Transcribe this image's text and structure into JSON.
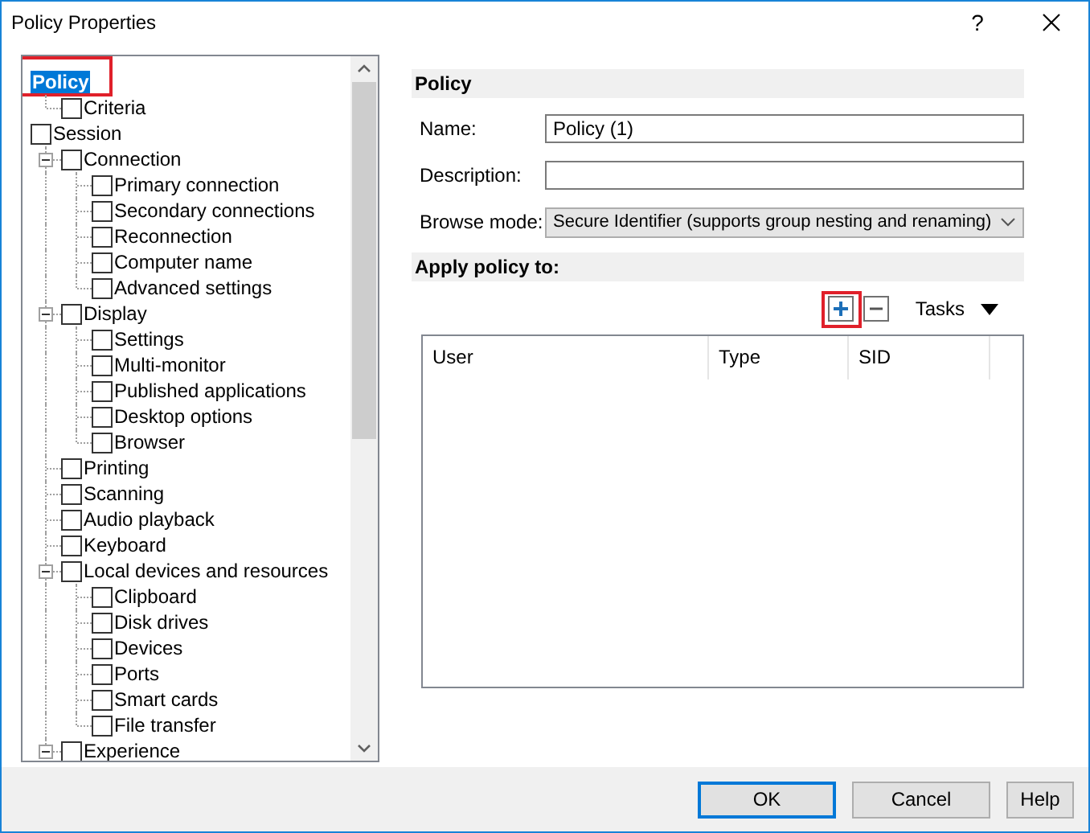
{
  "window": {
    "title": "Policy Properties",
    "help": "?"
  },
  "tree": [
    {
      "label": "Policy",
      "kind": "plain",
      "selected": true,
      "highlighted": true,
      "children": [
        {
          "label": "Criteria",
          "kind": "check",
          "checked": false,
          "selected": false
        }
      ]
    },
    {
      "label": "Session",
      "kind": "check",
      "checked": false,
      "selected": false,
      "children": [
        {
          "label": "Connection",
          "kind": "check",
          "checked": false,
          "selected": false,
          "expanded": true,
          "children": [
            {
              "label": "Primary connection",
              "kind": "check",
              "checked": false,
              "selected": false
            },
            {
              "label": "Secondary connections",
              "kind": "check",
              "checked": false,
              "selected": false
            },
            {
              "label": "Reconnection",
              "kind": "check",
              "checked": false,
              "selected": false
            },
            {
              "label": "Computer name",
              "kind": "check",
              "checked": false,
              "selected": false
            },
            {
              "label": "Advanced settings",
              "kind": "check",
              "checked": false,
              "selected": false
            }
          ]
        },
        {
          "label": "Display",
          "kind": "check",
          "checked": false,
          "selected": false,
          "expanded": true,
          "children": [
            {
              "label": "Settings",
              "kind": "check",
              "checked": false,
              "selected": false
            },
            {
              "label": "Multi-monitor",
              "kind": "check",
              "checked": false,
              "selected": false
            },
            {
              "label": "Published applications",
              "kind": "check",
              "checked": false,
              "selected": false
            },
            {
              "label": "Desktop options",
              "kind": "check",
              "checked": false,
              "selected": false
            },
            {
              "label": "Browser",
              "kind": "check",
              "checked": false,
              "selected": false
            }
          ]
        },
        {
          "label": "Printing",
          "kind": "check",
          "checked": false,
          "selected": false
        },
        {
          "label": "Scanning",
          "kind": "check",
          "checked": false,
          "selected": false
        },
        {
          "label": "Audio playback",
          "kind": "check",
          "checked": false,
          "selected": false
        },
        {
          "label": "Keyboard",
          "kind": "check",
          "checked": false,
          "selected": false
        },
        {
          "label": "Local devices and resources",
          "kind": "check",
          "checked": false,
          "selected": false,
          "expanded": true,
          "children": [
            {
              "label": "Clipboard",
              "kind": "check",
              "checked": false,
              "selected": false
            },
            {
              "label": "Disk drives",
              "kind": "check",
              "checked": false,
              "selected": false
            },
            {
              "label": "Devices",
              "kind": "check",
              "checked": false,
              "selected": false
            },
            {
              "label": "Ports",
              "kind": "check",
              "checked": false,
              "selected": false
            },
            {
              "label": "Smart cards",
              "kind": "check",
              "checked": false,
              "selected": false
            },
            {
              "label": "File transfer",
              "kind": "check",
              "checked": false,
              "selected": false
            }
          ]
        },
        {
          "label": "Experience",
          "kind": "check",
          "checked": false,
          "selected": false,
          "expanded": true
        }
      ]
    }
  ],
  "policy_section": {
    "title": "Policy",
    "fields": [
      {
        "label": "Name:",
        "kind": "text",
        "value": "Policy (1)"
      },
      {
        "label": "Description:",
        "kind": "text"
      },
      {
        "label": "Browse mode:",
        "kind": "select",
        "value": "Secure Identifier (supports group nesting and renaming)"
      }
    ]
  },
  "apply_section": {
    "title": "Apply policy to:",
    "add_highlighted": true,
    "tasks": "Tasks",
    "columns": [
      "User",
      "Type",
      "SID"
    ]
  },
  "buttons": [
    {
      "label": "OK",
      "default": true
    },
    {
      "label": "Cancel",
      "default": false
    },
    {
      "label": "Help",
      "default": false
    }
  ]
}
